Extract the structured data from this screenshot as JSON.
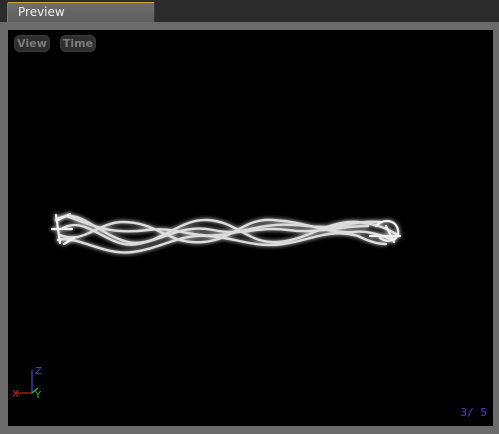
{
  "window": {
    "tab_title": "Preview"
  },
  "viewport": {
    "buttons": {
      "view": "View",
      "time": "Time"
    },
    "axis_labels": {
      "x": "X",
      "y": "Y",
      "z": "Z"
    },
    "frame_counter": {
      "current": "3/",
      "total": "5"
    }
  },
  "colors": {
    "background": "#000000",
    "panel": "#6b6b6b",
    "tab_accent": "#c9a83a",
    "axis_x": "#d22020",
    "axis_y": "#2fb84a",
    "axis_z": "#3a4fd6",
    "counter": "#5b3ad6"
  }
}
